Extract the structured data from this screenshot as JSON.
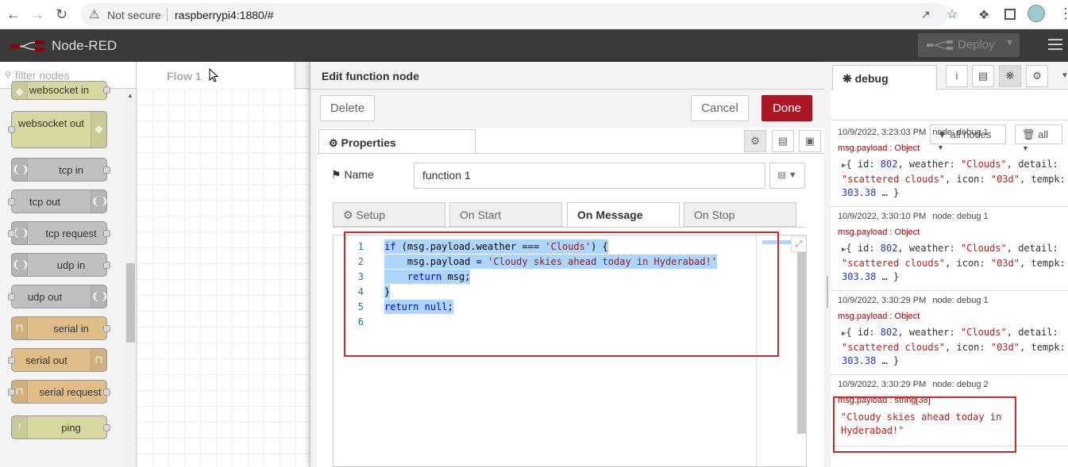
{
  "browser": {
    "security_label": "Not secure",
    "url": "raspberrypi4:1880/#"
  },
  "header": {
    "title": "Node-RED",
    "deploy_label": "Deploy"
  },
  "palette": {
    "filter_placeholder": "filter nodes",
    "nodes": [
      {
        "label": "websocket in"
      },
      {
        "label": "websocket out"
      },
      {
        "label": "tcp in"
      },
      {
        "label": "tcp out"
      },
      {
        "label": "tcp request"
      },
      {
        "label": "udp in"
      },
      {
        "label": "udp out"
      },
      {
        "label": "serial in"
      },
      {
        "label": "serial out"
      },
      {
        "label": "serial request"
      },
      {
        "label": "ping"
      }
    ]
  },
  "workspace": {
    "tab_label": "Flow 1"
  },
  "tray": {
    "title": "Edit function node",
    "delete_label": "Delete",
    "cancel_label": "Cancel",
    "done_label": "Done",
    "properties_tab": "Properties",
    "name_label": "Name",
    "name_value": "function 1",
    "subtabs": [
      "Setup",
      "On Start",
      "On Message",
      "On Stop"
    ],
    "line_numbers": [
      "1",
      "2",
      "3",
      "4",
      "5",
      "6"
    ]
  },
  "sidebar": {
    "tab_label": "debug",
    "filter_label": "all nodes",
    "clear_label": "all",
    "messages": [
      {
        "time": "10/9/2022, 3:23:03 PM",
        "node": "node: debug 1",
        "topic": "msg.payload : Object"
      },
      {
        "time": "10/9/2022, 3:30:10 PM",
        "node": "node: debug 1",
        "topic": "msg.payload : Object"
      },
      {
        "time": "10/9/2022, 3:30:29 PM",
        "node": "node: debug 1",
        "topic": "msg.payload : Object"
      },
      {
        "time": "10/9/2022, 3:30:29 PM",
        "node": "node: debug 2",
        "topic": "msg.payload : string[38]"
      }
    ],
    "string_payload_line1": "\"Cloudy skies ahead today in",
    "string_payload_line2": "Hyderabad!\""
  },
  "colors": {
    "header_bg": "#3a3a3a",
    "done_button": "#ad1625",
    "highlight_box": "#d02929",
    "selection": "#add6ff"
  }
}
